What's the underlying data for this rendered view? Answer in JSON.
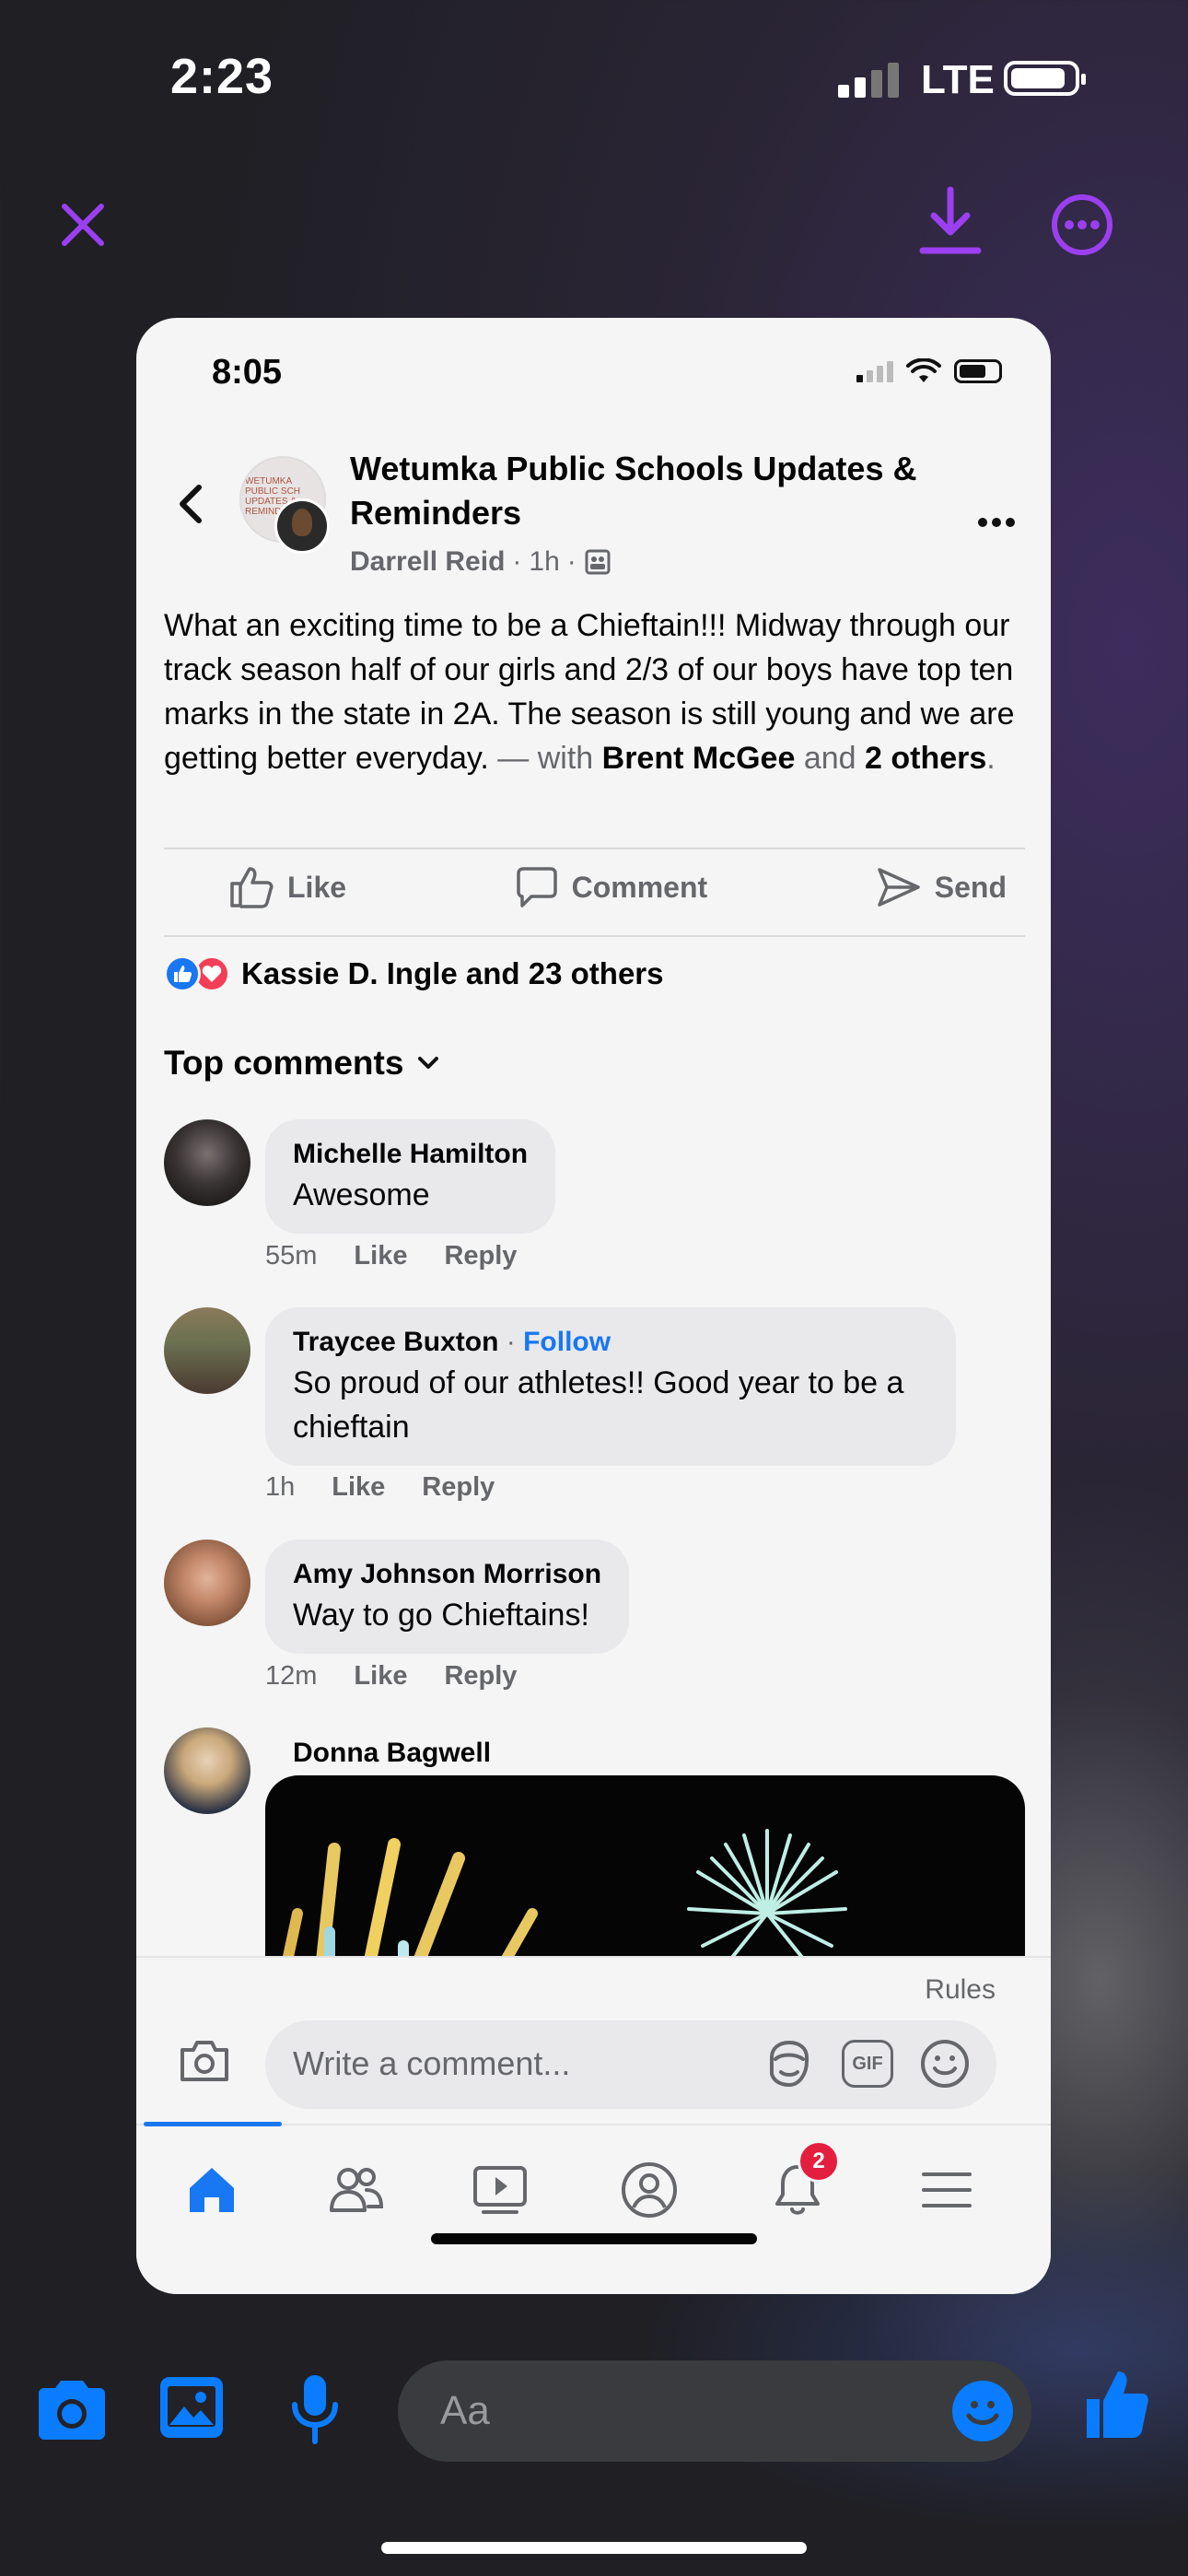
{
  "os_status": {
    "time": "2:23",
    "network": "LTE"
  },
  "viewer": {
    "close_icon": "close-icon",
    "download_icon": "download-icon",
    "more_icon": "more-icon"
  },
  "inner_status": {
    "time": "8:05"
  },
  "post": {
    "group_name": "Wetumka Public Schools Updates & Reminders",
    "author": "Darrell Reid",
    "time": "1h",
    "text_main": "What an exciting time to be a Chieftain!!!  Midway through our track season half of our girls and 2/3 of our boys have top ten marks in the state in 2A. The season is still young and we are getting better everyday.",
    "with_label": "— with",
    "tag_person": "Brent McGee",
    "and_label": "and",
    "tag_others": "2 others",
    "period": "."
  },
  "actions": {
    "like": "Like",
    "comment": "Comment",
    "send": "Send"
  },
  "reactions": {
    "text": "Kassie D. Ingle and 23 others"
  },
  "comments_header": "Top comments",
  "comments": [
    {
      "name": "Michelle Hamilton",
      "text": "Awesome",
      "time": "55m",
      "like": "Like",
      "reply": "Reply"
    },
    {
      "name": "Traycee Buxton",
      "follow": "Follow",
      "text": "So proud of our athletes!! Good year to be a chieftain",
      "time": "1h",
      "like": "Like",
      "reply": "Reply"
    },
    {
      "name": "Amy Johnson Morrison",
      "text": "Way to go Chieftains!",
      "time": "12m",
      "like": "Like",
      "reply": "Reply"
    },
    {
      "name": "Donna Bagwell"
    }
  ],
  "composer": {
    "rules": "Rules",
    "placeholder": "Write a comment...",
    "gif": "GIF"
  },
  "tabbar": {
    "notification_count": "2"
  },
  "messenger": {
    "placeholder": "Aa"
  },
  "colors": {
    "accent": "#9b3ff0",
    "facebook_blue": "#1877f2",
    "messenger_blue": "#0a7cff",
    "badge_red": "#e41e3f"
  }
}
